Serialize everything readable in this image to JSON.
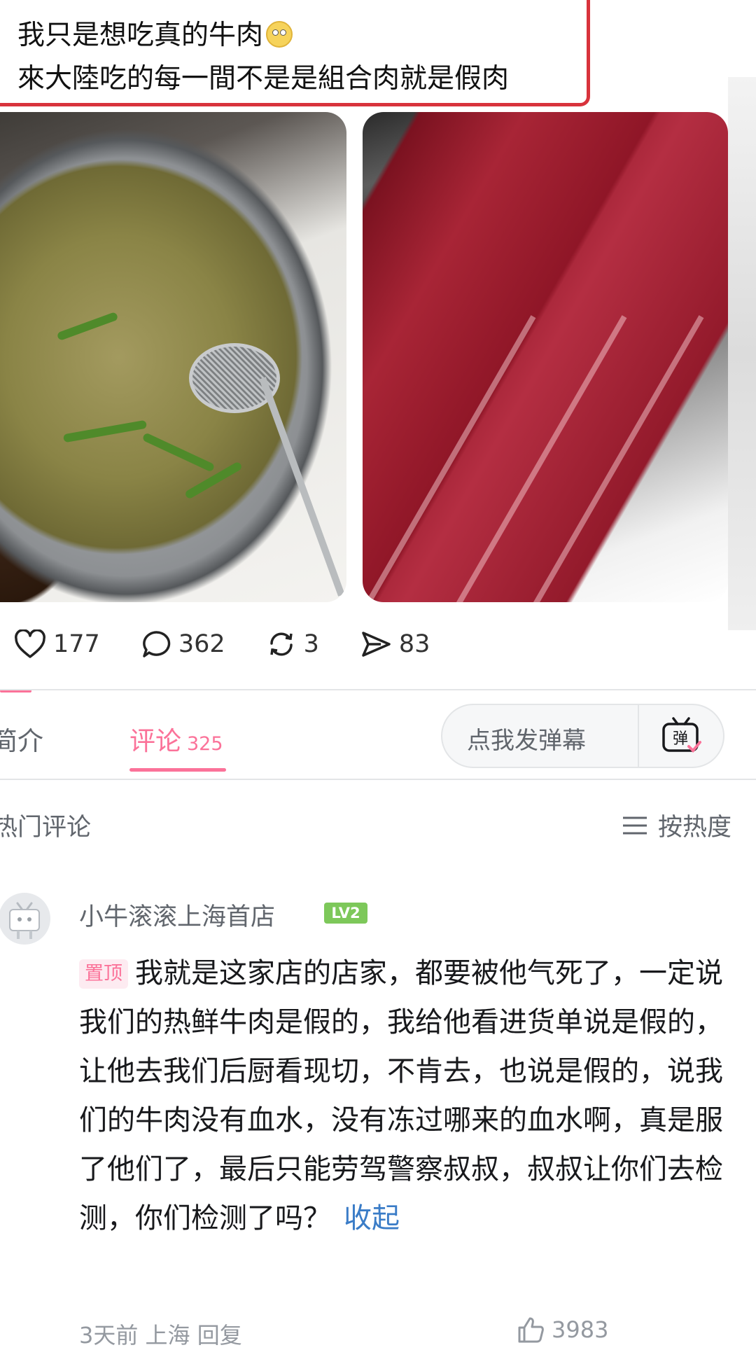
{
  "post": {
    "line1": "我只是想吃真的牛肉",
    "line2": "來大陸吃的每一間不是是組合肉就是假肉"
  },
  "stats": {
    "likes": "177",
    "comments": "362",
    "reposts": "3",
    "shares": "83"
  },
  "tabs": {
    "intro": "简介",
    "comments_label": "评论",
    "comments_count": "325"
  },
  "danmaku": {
    "placeholder": "点我发弹幕",
    "button_label": "弹"
  },
  "hot_comments": {
    "title": "热门评论",
    "sort_label": "按热度"
  },
  "comment": {
    "username": "小牛滚滚上海首店",
    "level": "LV2",
    "pin_label": "置顶",
    "text": "我就是这家店的店家，都要被他气死了，一定说我们的热鲜牛肉是假的，我给他看进货单说是假的，让他去我们后厨看现切，不肯去，也说是假的，说我们的牛肉没有血水，没有冻过哪来的血水啊，真是服了他们了，最后只能劳驾警察叔叔，叔叔让你们去检测，你们检测了吗？",
    "collapse_label": "收起",
    "meta": "3天前 上海  回复",
    "likes": "3983"
  },
  "colors": {
    "accent": "#fb7299",
    "highlight_border": "#d8333c",
    "link": "#3a7cc7",
    "level_badge": "#7dc85a"
  }
}
